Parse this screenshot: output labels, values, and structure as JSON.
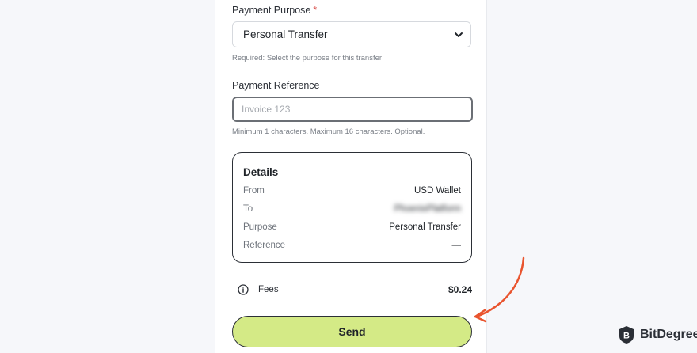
{
  "form": {
    "purpose_label": "Payment Purpose",
    "required_marker": "*",
    "purpose_value": "Personal Transfer",
    "purpose_hint": "Required: Select the purpose for this transfer",
    "reference_label": "Payment Reference",
    "reference_placeholder": "Invoice 123",
    "reference_value": "",
    "reference_hint": "Minimum 1 characters. Maximum 16 characters. Optional."
  },
  "details": {
    "title": "Details",
    "rows": [
      {
        "key": "From",
        "value": "USD Wallet"
      },
      {
        "key": "To",
        "value": "PhoenixPlatform"
      },
      {
        "key": "Purpose",
        "value": "Personal Transfer"
      },
      {
        "key": "Reference",
        "value": "—"
      }
    ]
  },
  "fees": {
    "label": "Fees",
    "amount": "$0.24",
    "icon": "info-icon"
  },
  "send_button": {
    "label": "Send",
    "color": "#d4ea86"
  },
  "annotation": {
    "arrow_color": "#e9542e"
  },
  "watermark": {
    "text": "BitDegree"
  }
}
